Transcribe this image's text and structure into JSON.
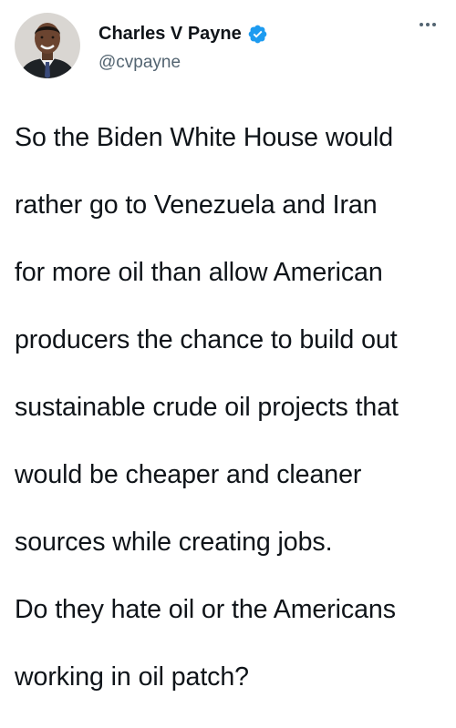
{
  "tweet": {
    "author": {
      "display_name": "Charles V Payne",
      "handle": "@cvpayne",
      "verified": true
    },
    "more_icon": "more-horizontal-icon",
    "text_lines": [
      "So the Biden White House would",
      "rather go to Venezuela and Iran",
      "for more oil than allow American",
      "producers the chance to build out",
      "sustainable crude oil projects that",
      "would be cheaper and cleaner",
      "sources while creating jobs.",
      "Do they hate oil or the Americans",
      "working in oil patch?"
    ]
  },
  "colors": {
    "text_primary": "#0f1419",
    "text_secondary": "#536471",
    "verified_blue": "#1d9bf0",
    "background": "#ffffff"
  }
}
